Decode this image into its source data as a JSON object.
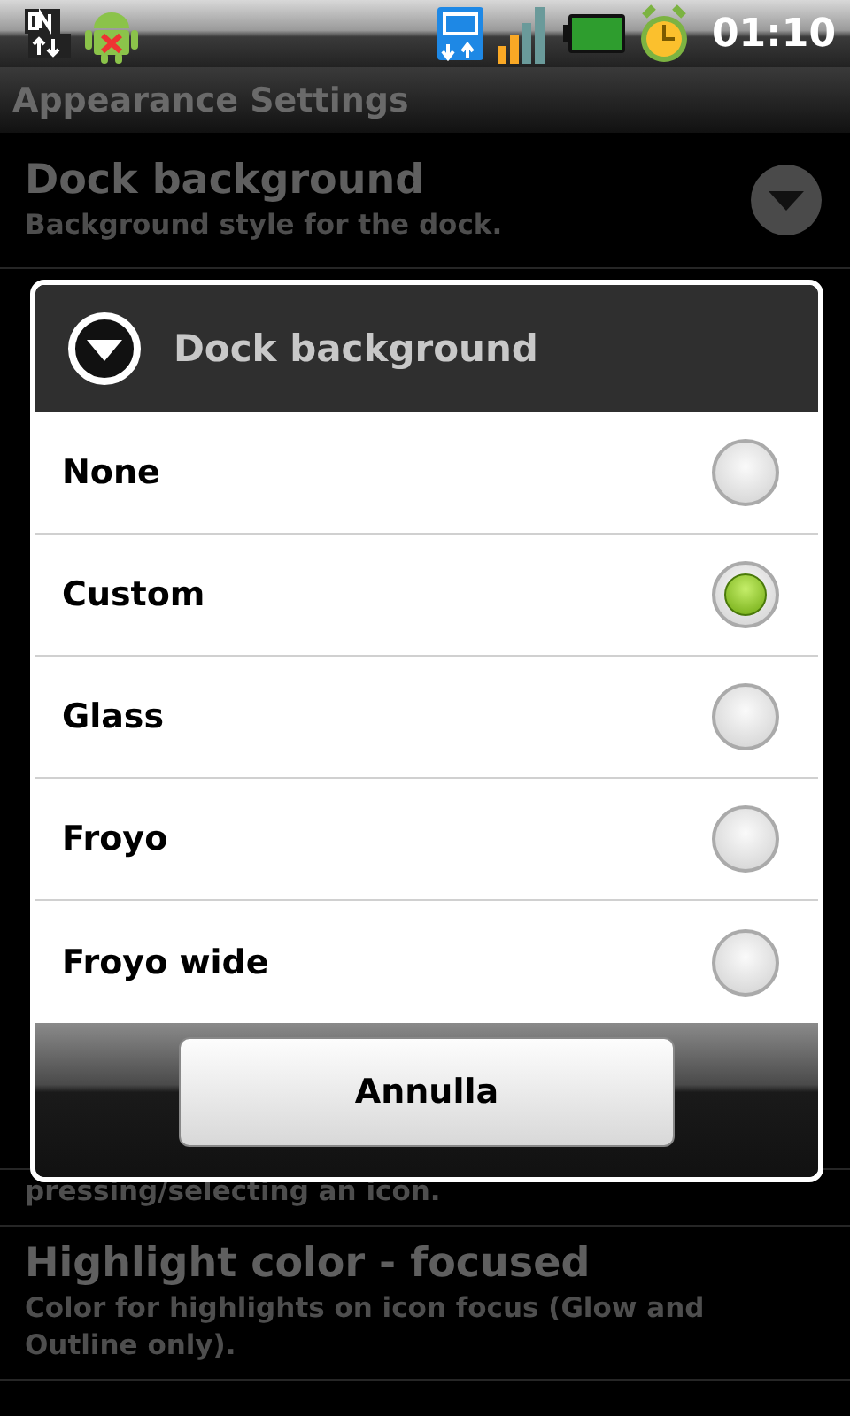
{
  "status_bar": {
    "time": "01:10"
  },
  "title_bar": {
    "title": "Appearance Settings"
  },
  "settings": [
    {
      "kind": "dropdown",
      "title": "Dock background",
      "summary": "Background style for the dock."
    },
    {
      "kind": "hidden"
    },
    {
      "kind": "tail",
      "summary": "pressing/selecting an icon."
    },
    {
      "kind": "plain",
      "title": "Highlight color - focused",
      "summary": "Color for highlights on icon focus (Glow and Outline only)."
    }
  ],
  "dialog": {
    "title": "Dock background",
    "options": [
      {
        "label": "None",
        "selected": false
      },
      {
        "label": "Custom",
        "selected": true
      },
      {
        "label": "Glass",
        "selected": false
      },
      {
        "label": "Froyo",
        "selected": false
      },
      {
        "label": "Froyo wide",
        "selected": false
      }
    ],
    "buttons": [
      "Annulla"
    ]
  }
}
